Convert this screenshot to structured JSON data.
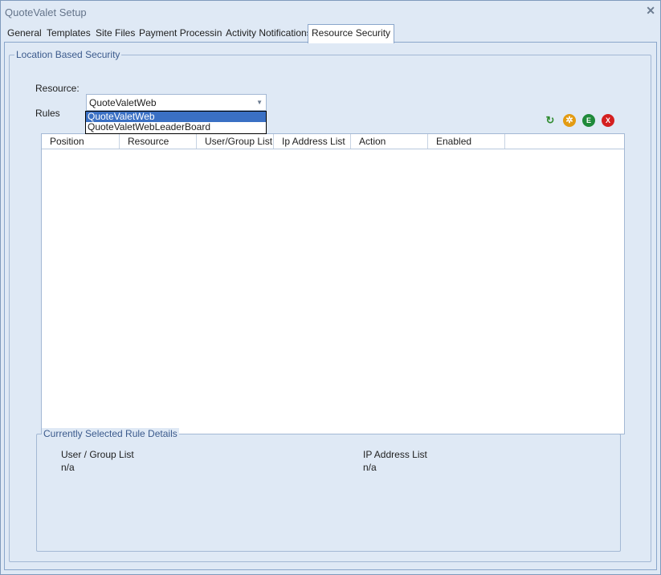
{
  "window": {
    "title": "QuoteValet Setup",
    "close_glyph": "✕"
  },
  "tabs": [
    {
      "label": "General"
    },
    {
      "label": "Templates"
    },
    {
      "label": "Site Files"
    },
    {
      "label": "Payment Processing"
    },
    {
      "label": "Activity Notifications"
    },
    {
      "label": "Resource Security",
      "active": true
    }
  ],
  "location_security": {
    "group_label": "Location Based Security",
    "resource_label": "Resource:",
    "resource_value": "QuoteValetWeb",
    "dropdown_options": [
      "QuoteValetWeb",
      "QuoteValetWebLeaderBoard"
    ],
    "rules_label": "Rules",
    "toolbar": [
      {
        "icon": "refresh-icon",
        "color": "#2e8b2e"
      },
      {
        "icon": "add-icon",
        "color": "#e39b12"
      },
      {
        "icon": "edit-icon",
        "color": "#1f8a3a",
        "glyph": "E"
      },
      {
        "icon": "delete-icon",
        "color": "#d42020",
        "glyph": "X"
      }
    ],
    "columns": [
      "Position",
      "Resource",
      "User/Group List",
      "Ip Address List",
      "Action",
      "Enabled"
    ]
  },
  "details": {
    "group_label": "Currently Selected Rule Details",
    "user_group_label": "User / Group List",
    "user_group_value": "n/a",
    "ip_label": "IP Address List",
    "ip_value": "n/a"
  }
}
